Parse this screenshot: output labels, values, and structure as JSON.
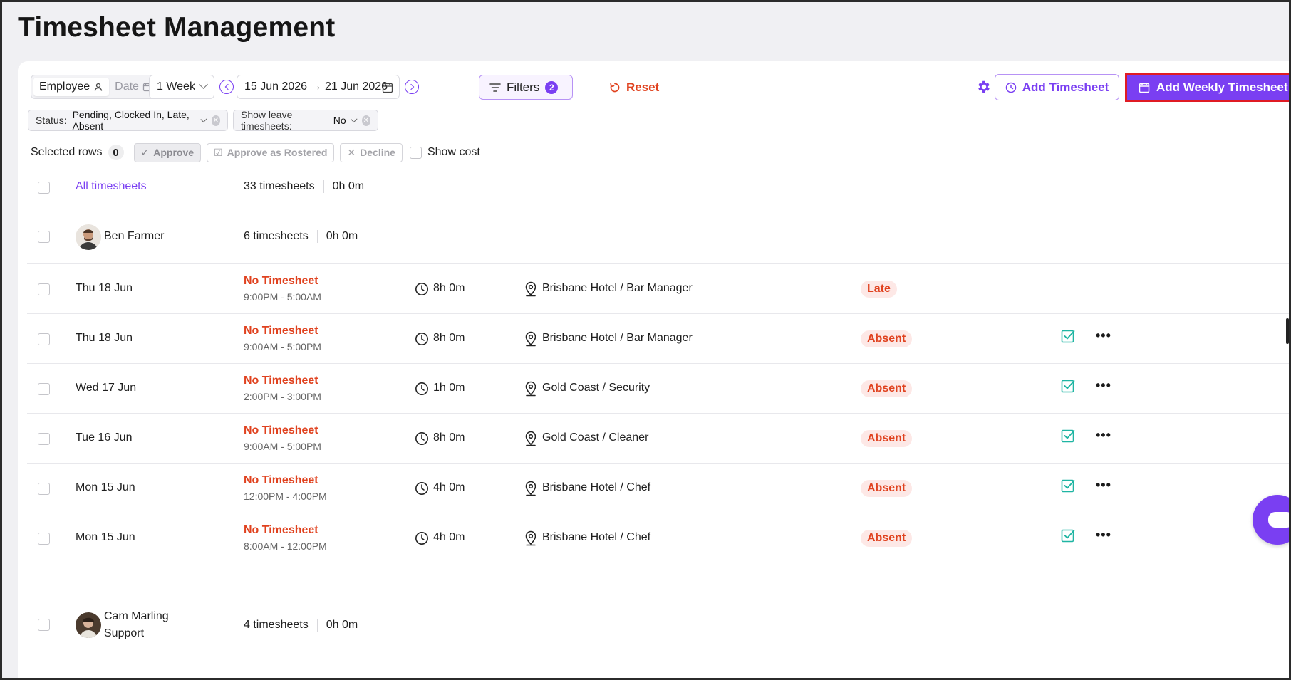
{
  "page": {
    "title": "Timesheet Management"
  },
  "toolbar": {
    "view_employee": "Employee",
    "view_date": "Date",
    "period": "1 Week",
    "date_range": "15 Jun 2026 → 21 Jun 2026",
    "filters_label": "Filters",
    "filters_count": "2",
    "reset_label": "Reset",
    "add_timesheet": "Add Timesheet",
    "add_weekly": "Add Weekly Timesheet"
  },
  "chips": {
    "status_key": "Status:",
    "status_value": "Pending, Clocked In, Late, Absent",
    "leave_key": "Show leave timesheets:",
    "leave_value": "No"
  },
  "selection": {
    "label": "Selected rows",
    "count": "0",
    "approve": "Approve",
    "approve_rostered": "Approve as Rostered",
    "decline": "Decline",
    "show_cost": "Show cost"
  },
  "summary": {
    "label": "All timesheets",
    "count": "33 timesheets",
    "hours": "0h 0m"
  },
  "groups": [
    {
      "name": "Ben Farmer",
      "count": "6 timesheets",
      "hours": "0h 0m"
    },
    {
      "name": "Cam Marling",
      "role": "Support",
      "count": "4 timesheets",
      "hours": "0h 0m"
    }
  ],
  "rows": [
    {
      "date": "Thu 18 Jun",
      "status": "No Timesheet",
      "time": "9:00PM - 5:00AM",
      "duration": "8h 0m",
      "location": "Brisbane Hotel / Bar Manager",
      "badge": "Late"
    },
    {
      "date": "Thu 18 Jun",
      "status": "No Timesheet",
      "time": "9:00AM - 5:00PM",
      "duration": "8h 0m",
      "location": "Brisbane Hotel / Bar Manager",
      "badge": "Absent"
    },
    {
      "date": "Wed 17 Jun",
      "status": "No Timesheet",
      "time": "2:00PM - 3:00PM",
      "duration": "1h 0m",
      "location": "Gold Coast / Security",
      "badge": "Absent"
    },
    {
      "date": "Tue 16 Jun",
      "status": "No Timesheet",
      "time": "9:00AM - 5:00PM",
      "duration": "8h 0m",
      "location": "Gold Coast / Cleaner",
      "badge": "Absent"
    },
    {
      "date": "Mon 15 Jun",
      "status": "No Timesheet",
      "time": "12:00PM - 4:00PM",
      "duration": "4h 0m",
      "location": "Brisbane Hotel / Chef",
      "badge": "Absent"
    },
    {
      "date": "Mon 15 Jun",
      "status": "No Timesheet",
      "time": "8:00AM - 12:00PM",
      "duration": "4h 0m",
      "location": "Brisbane Hotel / Chef",
      "badge": "Absent"
    }
  ],
  "colors": {
    "accent": "#7a3ff2",
    "danger": "#e0421f",
    "badge_bg": "#fde8e6",
    "teal": "#1fb5a3"
  },
  "icons": [
    "settings-icon",
    "calendar-icon",
    "clock-icon",
    "location-pin-icon",
    "approve-check-icon",
    "more-icon",
    "reset-icon",
    "filter-icon",
    "chat-icon"
  ]
}
